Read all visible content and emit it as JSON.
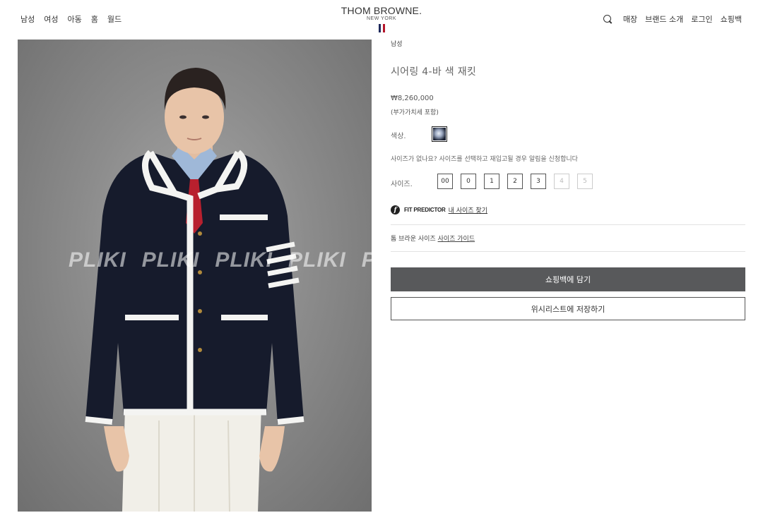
{
  "header": {
    "nav_left": [
      "남성",
      "여성",
      "아동",
      "홈",
      "월드"
    ],
    "logo": {
      "main": "THOM BROWNE.",
      "sub": "NEW YORK"
    },
    "flag_colors": [
      "#1f2a5c",
      "#ffffff",
      "#b5162b"
    ],
    "nav_right": [
      "매장",
      "브랜드 소개",
      "로그인",
      "쇼핑백"
    ]
  },
  "image": {
    "watermark": [
      "PLIKI",
      "PLIKI",
      "PLIKI",
      "PLIKI",
      "PL"
    ]
  },
  "product": {
    "breadcrumb": "남성",
    "title": "시어링 4-바 색 재킷",
    "price": "₩8,260,000",
    "vat_note": "(부가가치세 포함)",
    "color_label": "색상.",
    "size_note": "사이즈가 없나요? 사이즈를 선택하고 재입고될 경우 알림을 신청합니다",
    "size_label": "사이즈.",
    "sizes": [
      {
        "label": "00",
        "available": true
      },
      {
        "label": "0",
        "available": true
      },
      {
        "label": "1",
        "available": true
      },
      {
        "label": "2",
        "available": true
      },
      {
        "label": "3",
        "available": true
      },
      {
        "label": "4",
        "available": false
      },
      {
        "label": "5",
        "available": false
      }
    ],
    "fit_predictor": {
      "icon": "f",
      "brand": "FIT PREDICTOR",
      "link": "내 사이즈 찾기"
    },
    "size_guide": {
      "prefix": "톰 브라운 사이즈",
      "link": "사이즈 가이드"
    },
    "add_to_bag": "쇼핑백에 담기",
    "add_to_wishlist": "위시리스트에 저장하기"
  }
}
